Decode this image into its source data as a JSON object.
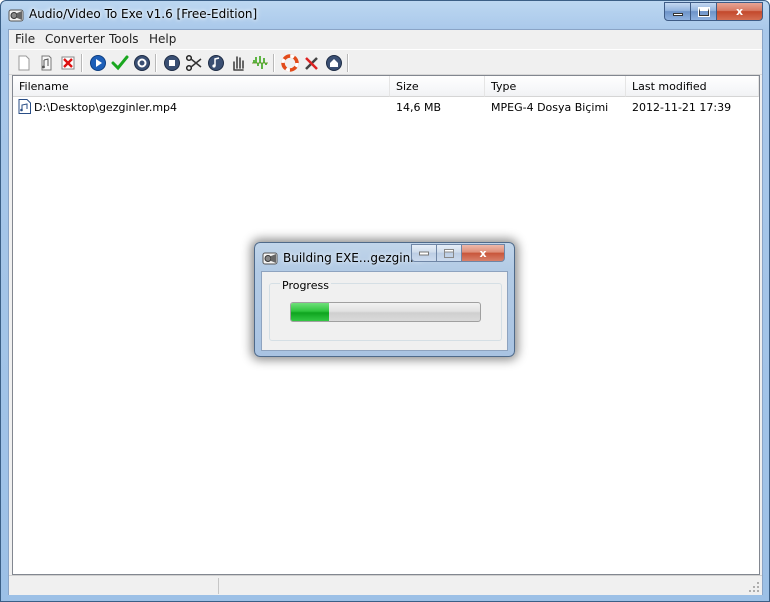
{
  "window": {
    "title": "Audio/Video To Exe v1.6 [Free-Edition]",
    "close_glyph": "x"
  },
  "menu": [
    {
      "label": "File"
    },
    {
      "label": "Converter"
    },
    {
      "label": "Tools"
    },
    {
      "label": "Help"
    }
  ],
  "toolbar": [
    {
      "name": "new-icon"
    },
    {
      "name": "open-icon"
    },
    {
      "name": "delete-icon"
    },
    {
      "name": "play-icon"
    },
    {
      "name": "check-icon"
    },
    {
      "name": "settings-icon"
    },
    {
      "name": "stop-icon"
    },
    {
      "name": "cut-icon"
    },
    {
      "name": "music-icon"
    },
    {
      "name": "hand-icon"
    },
    {
      "name": "waveform-icon"
    },
    {
      "name": "lifebuoy-icon"
    },
    {
      "name": "tools-icon"
    },
    {
      "name": "home-icon"
    }
  ],
  "file_list": {
    "columns": [
      "Filename",
      "Size",
      "Type",
      "Last modified"
    ],
    "rows": [
      {
        "filename": "D:\\Desktop\\gezginler.mp4",
        "size": "14,6 MB",
        "type": "MPEG-4 Dosya Biçimi",
        "modified": "2012-11-21 17:39"
      }
    ]
  },
  "dialog": {
    "title": "Building EXE...gezginler....",
    "close_glyph": "x",
    "group_label": "Progress",
    "progress": 0.2
  },
  "colors": {
    "progress_fill": "#2fc43e",
    "close_button": "#c8553a"
  }
}
